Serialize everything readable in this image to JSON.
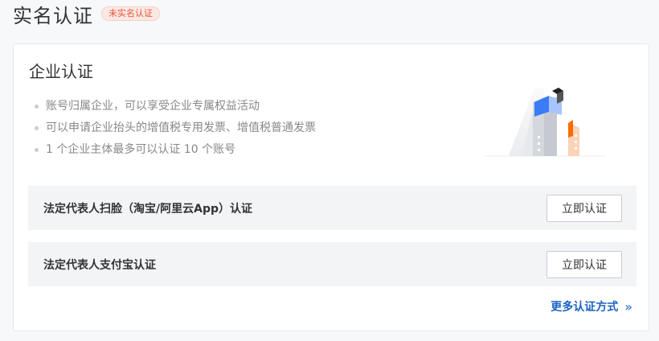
{
  "header": {
    "title": "实名认证",
    "status_badge": "未实名认证"
  },
  "card": {
    "title": "企业认证",
    "benefits": [
      "账号归属企业，可以享受企业专属权益活动",
      "可以申请企业抬头的增值税专用发票、增值税普通发票",
      "1 个企业主体最多可以认证 10 个账号"
    ],
    "methods": [
      {
        "label": "法定代表人扫脸（淘宝/阿里云App）认证",
        "button": "立即认证"
      },
      {
        "label": "法定代表人支付宝认证",
        "button": "立即认证"
      }
    ],
    "more_link": "更多认证方式",
    "more_icon": "double-chevron-right-icon"
  },
  "colors": {
    "badge_text": "#e5553a",
    "badge_bg": "#fde9e4",
    "link": "#1a63c4",
    "illustration_blue": "#3b7bf5",
    "illustration_orange": "#ff6a00"
  }
}
